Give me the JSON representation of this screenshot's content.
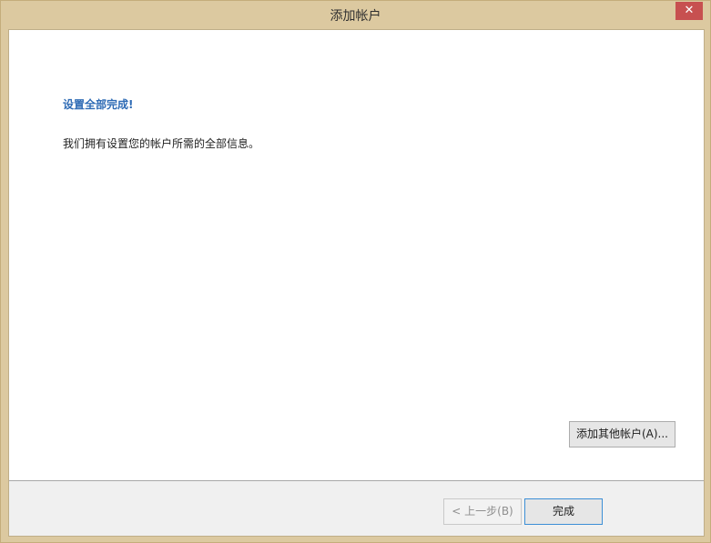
{
  "window": {
    "title": "添加帐户",
    "close_label": "✕"
  },
  "main": {
    "heading": "设置全部完成!",
    "message": "我们拥有设置您的帐户所需的全部信息。",
    "add_another_label": "添加其他帐户(A)..."
  },
  "footer": {
    "back_label": "< 上一步(B)",
    "finish_label": "完成"
  },
  "colors": {
    "frame": "#dcc9a0",
    "heading": "#2e6bb5",
    "close": "#c75050"
  }
}
